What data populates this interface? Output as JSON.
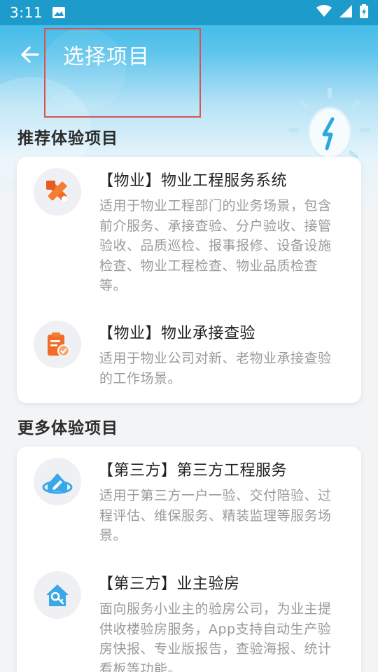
{
  "status": {
    "time": "3:11"
  },
  "header": {
    "title": "选择项目"
  },
  "sections": [
    {
      "title": "推荐体验项目",
      "items": [
        {
          "name": "【物业】物业工程服务系统",
          "desc": "适用于物业工程部门的业务场景，包含前介服务、承接查验、分户验收、接管验收、品质巡检、报事报修、设备设施检查、物业工程检查、物业品质检查等。",
          "icon": "tools-icon"
        },
        {
          "name": "【物业】物业承接查验",
          "desc": "适用于物业公司对新、老物业承接查验的工作场景。",
          "icon": "clipboard-check-icon"
        }
      ]
    },
    {
      "title": "更多体验项目",
      "items": [
        {
          "name": "【第三方】第三方工程服务",
          "desc": "适用于第三方一户一验、交付陪验、过程评估、维保服务、精装监理等服务场景。",
          "icon": "house-edit-icon"
        },
        {
          "name": "【第三方】业主验房",
          "desc": "面向服务小业主的验房公司，为业主提供收楼验房服务，App支持自动生产验房快报、专业版报告，查验海报、统计看板等功能。",
          "icon": "house-key-icon"
        }
      ]
    }
  ],
  "colors": {
    "accent": "#2eb4e6",
    "icon_orange": "#f26b2a",
    "icon_blue": "#3aa7e8"
  }
}
